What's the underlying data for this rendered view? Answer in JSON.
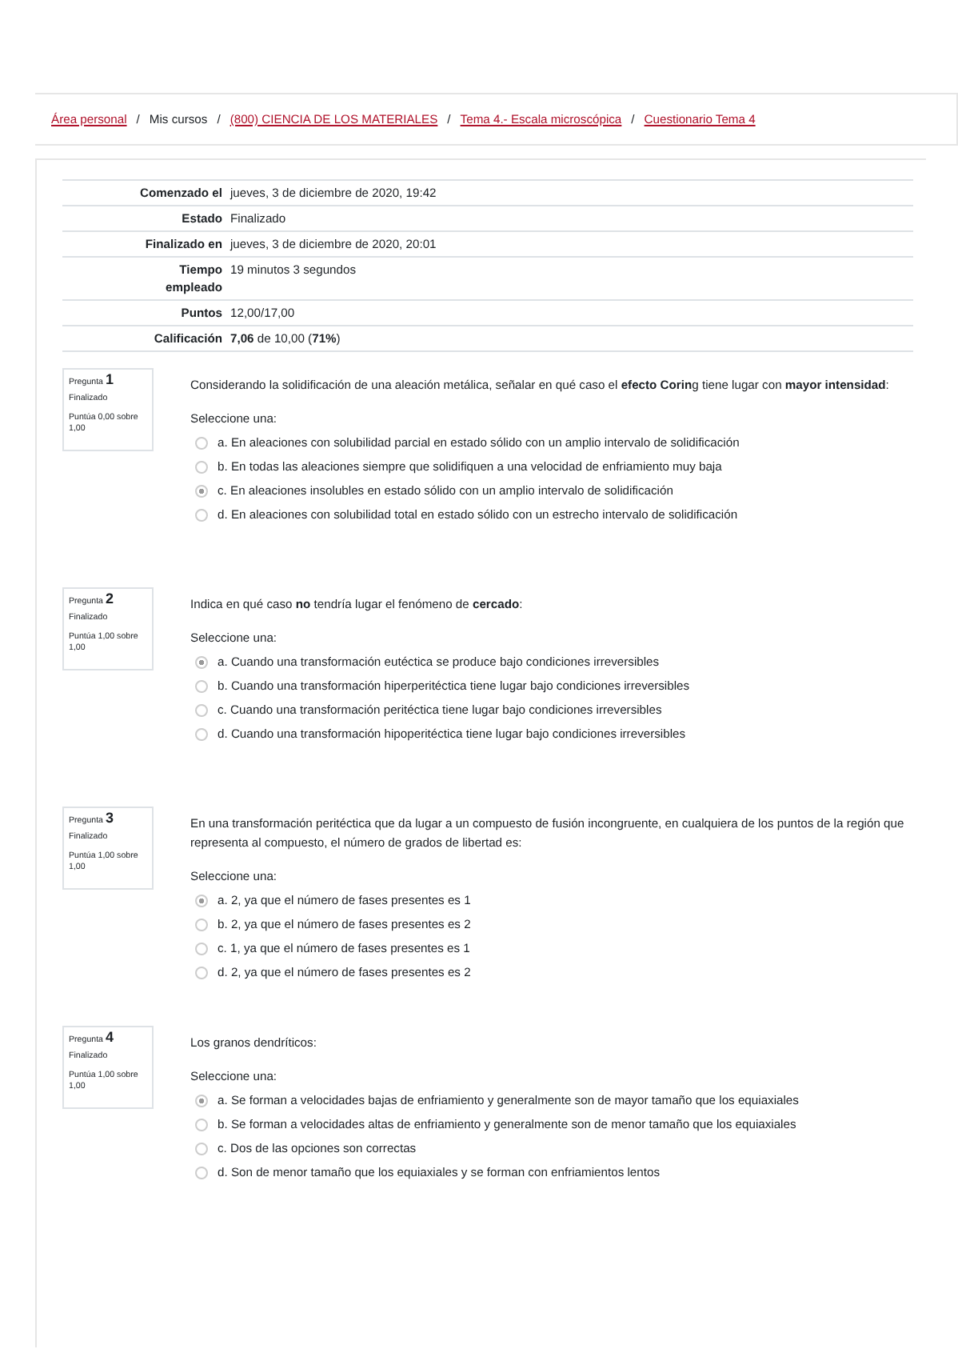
{
  "breadcrumb": [
    {
      "label": "Área personal",
      "link": true
    },
    {
      "label": "Mis cursos",
      "link": false
    },
    {
      "label": "(800) CIENCIA DE LOS MATERIALES",
      "link": true
    },
    {
      "label": "Tema 4.- Escala microscópica",
      "link": true
    },
    {
      "label": "Cuestionario Tema 4",
      "link": true
    }
  ],
  "breadcrumb_separator": "/",
  "summary": [
    {
      "label": "Comenzado el",
      "value": "jueves, 3 de diciembre de 2020, 19:42"
    },
    {
      "label": "Estado",
      "value": "Finalizado"
    },
    {
      "label": "Finalizado en",
      "value": "jueves, 3 de diciembre de 2020, 20:01"
    },
    {
      "label": "Tiempo empleado",
      "value": "19 minutos 3 segundos"
    },
    {
      "label": "Puntos",
      "value": "12,00/17,00"
    },
    {
      "label": "Calificación",
      "value": "**7,06** de 10,00 (**71%**)"
    }
  ],
  "questions": [
    {
      "label": "Pregunta",
      "number": "1",
      "state": "Finalizado",
      "score": "Puntúa 0,00 sobre 1,00",
      "text": "Considerando la solidificación de una aleación metálica, señalar en qué caso el **efecto Corin**g tiene lugar con **mayor intensidad**:",
      "prompt": "Seleccione una:",
      "options": [
        {
          "text": "a. En aleaciones con solubilidad parcial en estado sólido con un amplio intervalo de solidificación",
          "selected": false
        },
        {
          "text": "b. En todas las aleaciones siempre que solidifiquen a una velocidad de enfriamiento muy baja",
          "selected": false
        },
        {
          "text": "c. En aleaciones insolubles en estado sólido con un amplio intervalo de solidificación",
          "selected": true
        },
        {
          "text": "d. En aleaciones con solubilidad total en estado sólido con un estrecho intervalo de solidificación",
          "selected": false
        }
      ]
    },
    {
      "label": "Pregunta",
      "number": "2",
      "state": "Finalizado",
      "score": "Puntúa 1,00 sobre 1,00",
      "text": "Indica en qué caso **no** tendría lugar el fenómeno de **cercado**:",
      "prompt": "Seleccione una:",
      "options": [
        {
          "text": "a. Cuando una transformación eutéctica se produce bajo condiciones irreversibles",
          "selected": true
        },
        {
          "text": "b. Cuando una transformación hiperperitéctica tiene lugar bajo condiciones irreversibles",
          "selected": false
        },
        {
          "text": "c. Cuando una transformación peritéctica tiene lugar bajo condiciones irreversibles",
          "selected": false
        },
        {
          "text": "d. Cuando una transformación hipoperitéctica tiene lugar bajo condiciones irreversibles",
          "selected": false
        }
      ]
    },
    {
      "label": "Pregunta",
      "number": "3",
      "state": "Finalizado",
      "score": "Puntúa 1,00 sobre 1,00",
      "text": "En una transformación peritéctica que da lugar a un compuesto de fusión incongruente, en cualquiera de los puntos de la región que representa al compuesto, el número de grados de libertad es:",
      "prompt": "Seleccione una:",
      "options": [
        {
          "text": "a. 2, ya que el número de fases presentes es 1",
          "selected": true
        },
        {
          "text": "b. 2, ya que el número de fases presentes es 2",
          "selected": false
        },
        {
          "text": "c. 1, ya que el número de fases presentes es 1",
          "selected": false
        },
        {
          "text": "d. 2, ya que el número de fases presentes es 2",
          "selected": false
        }
      ]
    },
    {
      "label": "Pregunta",
      "number": "4",
      "state": "Finalizado",
      "score": "Puntúa 1,00 sobre 1,00",
      "text": "Los granos dendríticos:",
      "prompt": "Seleccione una:",
      "options": [
        {
          "text": "a. Se forman a velocidades bajas de enfriamiento y generalmente son de mayor tamaño que los equiaxiales",
          "selected": true
        },
        {
          "text": "b. Se forman a velocidades altas de enfriamiento y generalmente son de menor tamaño que los equiaxiales",
          "selected": false
        },
        {
          "text": "c. Dos de las opciones son correctas",
          "selected": false
        },
        {
          "text": "d. Son de menor tamaño que los equiaxiales y se forman con enfriamientos lentos",
          "selected": false
        }
      ]
    }
  ]
}
